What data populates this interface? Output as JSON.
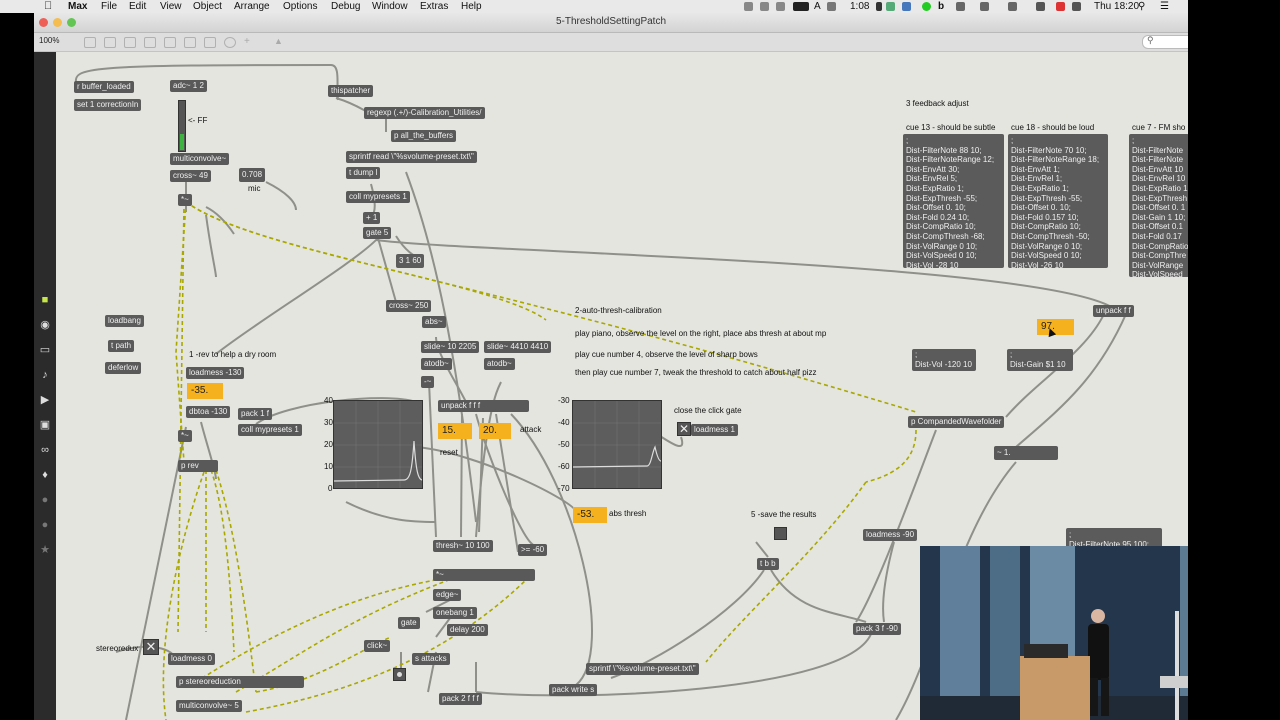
{
  "menubar": {
    "items": [
      "Max",
      "File",
      "Edit",
      "View",
      "Object",
      "Arrange",
      "Options",
      "Debug",
      "Window",
      "Extras",
      "Help"
    ],
    "clock": "Thu 18:20",
    "battery_time": "1:08"
  },
  "window": {
    "title": "5-ThresholdSettingPatch",
    "zoom": "100%"
  },
  "objects": [
    {
      "t": "r buffer_loaded"
    },
    {
      "t": "set 1 correctionIn"
    },
    {
      "t": "adc~ 1 2"
    },
    {
      "t": "multiconvolve~"
    },
    {
      "t": "cross~ 49"
    },
    {
      "t": "0.708"
    },
    {
      "t": "*~"
    },
    {
      "t": "thispatcher"
    },
    {
      "t": "regexp (.+/)-Calibration_Utilities/"
    },
    {
      "t": "p all_the_buffers"
    },
    {
      "t": "sprintf read \\\"%svolume-preset.txt\\\""
    },
    {
      "t": "t dump l"
    },
    {
      "t": "coll mypresets 1"
    },
    {
      "t": "+ 1"
    },
    {
      "t": "gate 5"
    },
    {
      "t": "3 1 60"
    },
    {
      "t": "cross~ 250"
    },
    {
      "t": "abs~"
    },
    {
      "t": "slide~ 10 2205"
    },
    {
      "t": "slide~ 4410 4410"
    },
    {
      "t": "atodb~"
    },
    {
      "t": "atodb~"
    },
    {
      "t": "-~"
    },
    {
      "t": "unpack f f f"
    },
    {
      "t": "loadbang"
    },
    {
      "t": "t path"
    },
    {
      "t": "deferlow"
    },
    {
      "t": "loadmess -130"
    },
    {
      "t": "dbtoa -130"
    },
    {
      "t": "pack 1 f"
    },
    {
      "t": "coll mypresets 1"
    },
    {
      "t": "*~"
    },
    {
      "t": "p rev"
    },
    {
      "t": "loadmess 1"
    },
    {
      "t": "thresh~ 10 100"
    },
    {
      "t": ">= -60"
    },
    {
      "t": "*~"
    },
    {
      "t": "edge~"
    },
    {
      "t": "onebang 1"
    },
    {
      "t": "delay 200"
    },
    {
      "t": "gate"
    },
    {
      "t": "click~"
    },
    {
      "t": "s attacks"
    },
    {
      "t": "loadmess 0"
    },
    {
      "t": "p stereoreduction"
    },
    {
      "t": "multiconvolve~ 5"
    },
    {
      "t": "pack 2 f f f"
    },
    {
      "t": "pack write s"
    },
    {
      "t": "sprintf \\\"%svolume-preset.txt\\\""
    },
    {
      "t": "t b b"
    },
    {
      "t": "loadmess -90"
    },
    {
      "t": "pack 3 f -90"
    },
    {
      "t": "p CompandedWavefolder"
    },
    {
      "t": "~ 1."
    },
    {
      "t": "unpack f f"
    },
    {
      "t": "Dist-Vol -120 10"
    },
    {
      "t": "Dist-Gain $1 10"
    }
  ],
  "numbers": {
    "n1": "-35.",
    "n2": "15.",
    "n3": "20.",
    "n4": "-53.",
    "n5": "97."
  },
  "labels": {
    "ff": "<- FF",
    "mic": "mic",
    "rev_help": "1 -rev to help a dry room",
    "reset": "reset",
    "attack": "attack",
    "abs_thresh": "abs thresh",
    "close_click": "close the click gate",
    "save": "5 -save the results",
    "stereoredux": "stereoredux",
    "feedback": "3 feedback adjust",
    "auto_title": "2-auto-thresh-calibration",
    "auto_1": "play piano, observe the level on the right, place abs thresh at about mp",
    "auto_2": "play cue number 4, observe the level of sharp bows",
    "auto_3": "then play cue number 7, tweak the threshold to catch about half pizz"
  },
  "scope_left_ticks": [
    "40",
    "30",
    "20",
    "10",
    "0"
  ],
  "scope_right_ticks": [
    "-30",
    "-40",
    "-50",
    "-60",
    "-70"
  ],
  "cues": [
    {
      "title": "cue 13 - should be subtle",
      "lines": [
        ";",
        "Dist-FilterNote 88 10;",
        "Dist-FilterNoteRange 12;",
        "Dist-EnvAtt 30;",
        "Dist-EnvRel 5;",
        "Dist-ExpRatio 1;",
        "Dist-ExpThresh -55;",
        "Dist-Offset 0. 10;",
        "Dist-Fold 0.24 10;",
        "Dist-CompRatio 10;",
        "Dist-CompThresh -68;",
        "Dist-VolRange 0 10;",
        "Dist-VolSpeed 0 10;",
        "Dist-Vol -28 10"
      ]
    },
    {
      "title": "cue 18 - should be loud",
      "lines": [
        ";",
        "Dist-FilterNote 70 10;",
        "Dist-FilterNoteRange 18;",
        "Dist-EnvAtt 1;",
        "Dist-EnvRel 1;",
        "Dist-ExpRatio 1;",
        "Dist-ExpThresh -55;",
        "Dist-Offset 0. 10;",
        "Dist-Fold 0.157 10;",
        "Dist-CompRatio 10;",
        "Dist-CompThresh -50;",
        "Dist-VolRange 0 10;",
        "Dist-VolSpeed 0 10;",
        "Dist-Vol -26 10"
      ]
    },
    {
      "title": "cue 7 - FM sho",
      "lines": [
        ";",
        "Dist-FilterNote",
        "Dist-FilterNote",
        "Dist-EnvAtt 10",
        "Dist-EnvRel 10",
        "Dist-ExpRatio 1",
        "Dist-ExpThresh",
        "Dist-Offset 0. 1",
        "Dist-Gain 1 10;",
        "Dist-Offset 0.1",
        "Dist-Fold 0.17",
        "Dist-CompRatio",
        "Dist-CompThre",
        "Dist-VolRange",
        "Dist-VolSpeed",
        "Dist-Vol -43 10"
      ]
    }
  ],
  "partial_msg": "Dist-FilterNote 95 100;",
  "colors": {
    "canvas": "#e4e5df",
    "object": "#595959",
    "number": "#f6b21e"
  }
}
